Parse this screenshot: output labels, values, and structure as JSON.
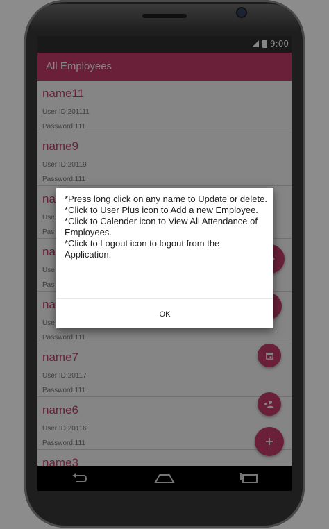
{
  "status_bar": {
    "time": "9:00",
    "icons": [
      "signal-icon",
      "battery-icon"
    ]
  },
  "app_bar": {
    "title": "All Employees"
  },
  "employees": [
    {
      "name": "name11",
      "user_id": "User ID:201111",
      "password": "Password:111"
    },
    {
      "name": "name9",
      "user_id": "User ID:20119",
      "password": "Password:111"
    },
    {
      "name": "na",
      "user_id": "Use",
      "password": "Pas"
    },
    {
      "name": "na",
      "user_id": "Use",
      "password": "Pas"
    },
    {
      "name": "na",
      "user_id": "Use",
      "password": "Password:111"
    },
    {
      "name": "name7",
      "user_id": "User ID:20117",
      "password": "Password:111"
    },
    {
      "name": "name6",
      "user_id": "User ID:20116",
      "password": "Password:111"
    },
    {
      "name": "name3",
      "user_id": "",
      "password": ""
    }
  ],
  "fabs": [
    "logout-icon",
    "calendar-icon",
    "calendar-icon",
    "user-plus-icon",
    "add-icon"
  ],
  "dialog": {
    "message": "*Press long click on any name to Update or delete.\n*Click to User Plus icon to Add a new Employee.\n*Click to Calender icon to View All Attendance of Employees.\n*Click to Logout icon to logout from the Application.",
    "ok_label": "OK"
  },
  "nav_bar": {
    "icons": [
      "back-icon",
      "home-icon",
      "recents-icon"
    ]
  },
  "colors": {
    "accent": "#cc3f6b",
    "status_bar": "#313131",
    "nav_bar": "#000000"
  }
}
